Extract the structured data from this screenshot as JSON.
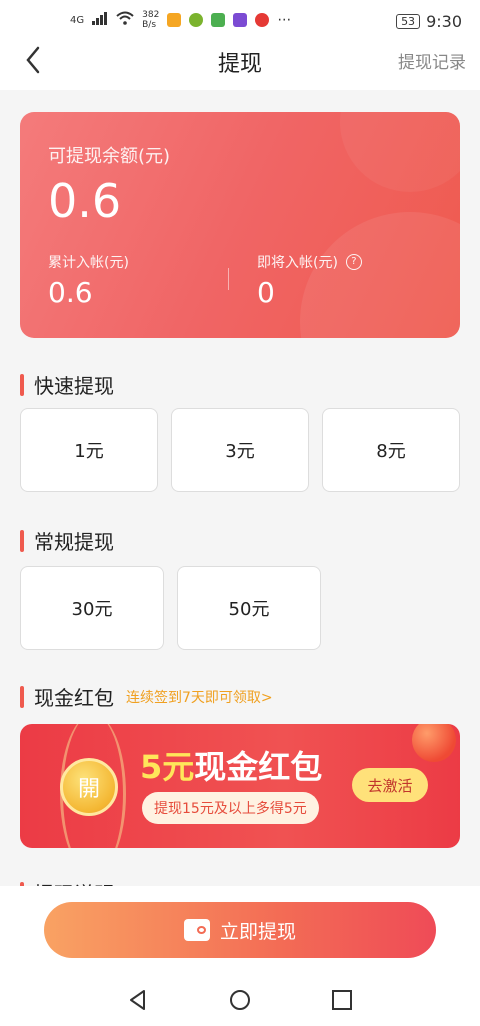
{
  "status_bar": {
    "network": "4G",
    "speed": "382\nB/s",
    "battery": "53",
    "time": "9:30"
  },
  "header": {
    "title": "提现",
    "record_link": "提现记录"
  },
  "balance": {
    "label": "可提现余额(元)",
    "amount": "0.6",
    "cumulative_label": "累计入帐(元)",
    "cumulative_value": "0.6",
    "pending_label": "即将入帐(元)",
    "pending_value": "0"
  },
  "quick": {
    "title": "快速提现",
    "options": [
      "1元",
      "3元",
      "8元"
    ]
  },
  "regular": {
    "title": "常规提现",
    "options": [
      "30元",
      "50元"
    ]
  },
  "cash_packet": {
    "title": "现金红包",
    "hint": "连续签到7天即可领取>",
    "coin_text": "開",
    "amount_text": "5元",
    "headline_text": "现金红包",
    "subtitle": "提现15元及以上多得5元",
    "button": "去激活"
  },
  "explain": {
    "title": "提现说明"
  },
  "submit": {
    "label": "立即提现"
  },
  "colors": {
    "accent": "#ef5a4e",
    "hint": "#f0a020"
  }
}
